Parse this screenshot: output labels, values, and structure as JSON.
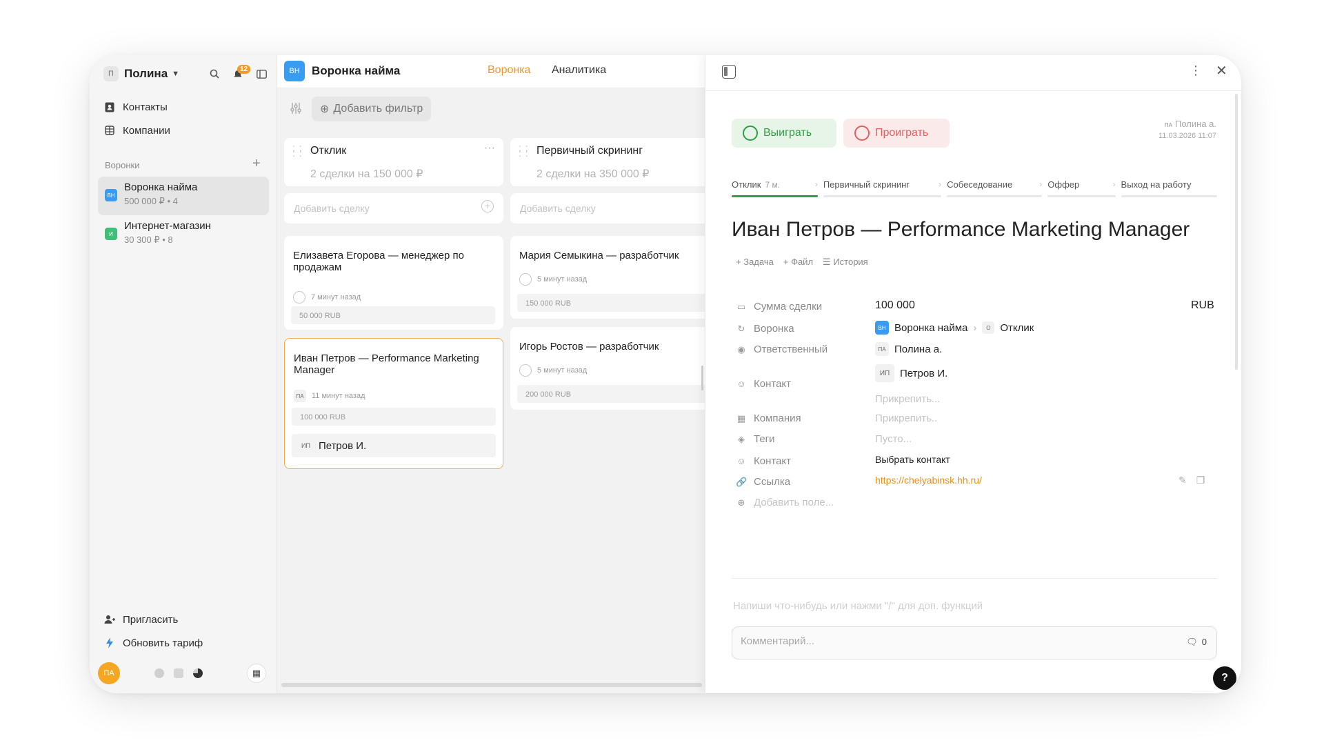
{
  "sidebar": {
    "workspace_avatar": "П",
    "workspace_name": "Полина",
    "notifications_count": "12",
    "nav": [
      {
        "label": "Контакты",
        "icon": "contact-book-icon"
      },
      {
        "label": "Компании",
        "icon": "building-icon"
      }
    ],
    "funnels_label": "Воронки",
    "funnels": [
      {
        "badge": "ВН",
        "badge_color": "#3a9cf0",
        "name": "Воронка найма",
        "meta": "500 000 ₽ • 4"
      },
      {
        "badge": "И",
        "badge_color": "#3ec07a",
        "name": "Интернет-магазин",
        "meta": "30 300 ₽ • 8"
      }
    ],
    "invite_label": "Пригласить",
    "upgrade_label": "Обновить тариф",
    "user_initials": "ПА"
  },
  "board": {
    "badge": "ВН",
    "title": "Воронка найма",
    "tabs": [
      {
        "label": "Воронка",
        "active": true
      },
      {
        "label": "Аналитика",
        "active": false
      }
    ],
    "filter_label": "Добавить фильтр",
    "columns": [
      {
        "title": "Отклик",
        "summary": "2 сделки на 150 000 ₽",
        "add_label": "Добавить сделку",
        "cards": [
          {
            "title": "Елизавета Егорова — менеджер по продажам",
            "time": "7 минут назад",
            "amount": "50 000 RUB"
          },
          {
            "title": "Иван Петров — Performance Marketing Manager",
            "initials": "ПА",
            "time": "11 минут назад",
            "amount": "100 000 RUB",
            "contact_initials": "ИП",
            "contact": "Петров И."
          }
        ]
      },
      {
        "title": "Первичный скрининг",
        "summary": "2 сделки на 350 000 ₽",
        "add_label": "Добавить сделку",
        "cards": [
          {
            "title": "Мария Семыкина — разработчик",
            "time": "5 минут назад",
            "amount": "150 000 RUB"
          },
          {
            "title": "Игорь Ростов — разработчик",
            "time": "5 минут назад",
            "amount": "200 000 RUB"
          }
        ]
      }
    ]
  },
  "detail": {
    "win_label": "Выиграть",
    "lose_label": "Проиграть",
    "author_initials": "ПА",
    "author": "Полина а.",
    "created": "11.03.2026 11:07",
    "stages": [
      {
        "label": "Отклик",
        "sub": "7 м.",
        "active": true
      },
      {
        "label": "Первичный скрининг",
        "sub": "",
        "active": false
      },
      {
        "label": "Собеседование",
        "sub": "",
        "active": false
      },
      {
        "label": "Оффер",
        "sub": "",
        "active": false
      },
      {
        "label": "Выход на работу",
        "sub": "",
        "active": false
      }
    ],
    "title": "Иван Петров — Performance Marketing Manager",
    "actions": {
      "task": "Задача",
      "file": "Файл",
      "history": "История"
    },
    "fields": {
      "amount_label": "Сумма сделки",
      "amount_value": "100 000",
      "currency": "RUB",
      "funnel_label": "Воронка",
      "funnel_badge": "ВН",
      "funnel_value": "Воронка найма",
      "stage_initial": "О",
      "stage_value": "Отклик",
      "owner_label": "Ответственный",
      "owner_initials": "ПА",
      "owner_value": "Полина а.",
      "contact_label": "Контакт",
      "contact_initials": "ИП",
      "contact_value": "Петров И.",
      "contact_attach": "Прикрепить...",
      "company_label": "Компания",
      "company_attach": "Прикрепить..",
      "tags_label": "Теги",
      "tags_value": "Пусто...",
      "contact2_label": "Контакт",
      "contact2_value": "Выбрать контакт",
      "link_label": "Ссылка",
      "link_value": "https://chelyabinsk.hh.ru/",
      "add_field": "Добавить поле..."
    },
    "editor_placeholder": "Напиши что-нибудь или нажми \"/\" для доп. функций",
    "comment_placeholder": "Комментарий...",
    "comment_count": "0"
  },
  "colors": {
    "accent": "#f0952a",
    "win": "#2f9e44",
    "lose": "#e06060",
    "link": "#e6901a"
  }
}
